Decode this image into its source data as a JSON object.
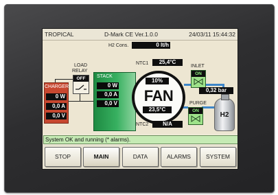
{
  "device_title": "TROPICAL",
  "software_version": "D-Mark CE Ver.1.0.0",
  "datetime": "24/03/11 15:44:32",
  "h2_consumption": {
    "label": "H2 Cons.",
    "value": "0 lt/h"
  },
  "load_relay": {
    "label_line1": "LOAD",
    "label_line2": "RELAY",
    "state": "OFF"
  },
  "charger": {
    "label": "CHARGER",
    "power": "0 W",
    "current": "0,0 A",
    "voltage": "0,0 V"
  },
  "stack": {
    "label": "STACK",
    "power": "0 W",
    "current": "0,0 A",
    "voltage": "0,0 V"
  },
  "fan": {
    "label": "FAN",
    "percent": "10%",
    "temperature": "23,5°C"
  },
  "ntc1": {
    "label": "NTC1",
    "value": "25,4°C"
  },
  "ntc2": {
    "label": "NTC2",
    "value": "N/A"
  },
  "inlet_valve": {
    "label": "INLET",
    "state": "ON"
  },
  "purge_valve": {
    "label": "PURGE",
    "state": "ON"
  },
  "pressure": "0,32 bar",
  "tank_label": "H2",
  "status_message": "System OK and running (* alarms).",
  "nav_buttons": [
    {
      "label": "STOP",
      "active": false
    },
    {
      "label": "MAIN",
      "active": true
    },
    {
      "label": "DATA",
      "active": false
    },
    {
      "label": "ALARMS",
      "active": false
    },
    {
      "label": "SYSTEM",
      "active": false
    }
  ],
  "colors": {
    "screen_bg": "#f0ead8",
    "charger": "#c7472f",
    "stack": "#37b060",
    "valve": "#9ee28a",
    "pipe": "#3e86c9",
    "status_bar": "#c5eab4"
  }
}
